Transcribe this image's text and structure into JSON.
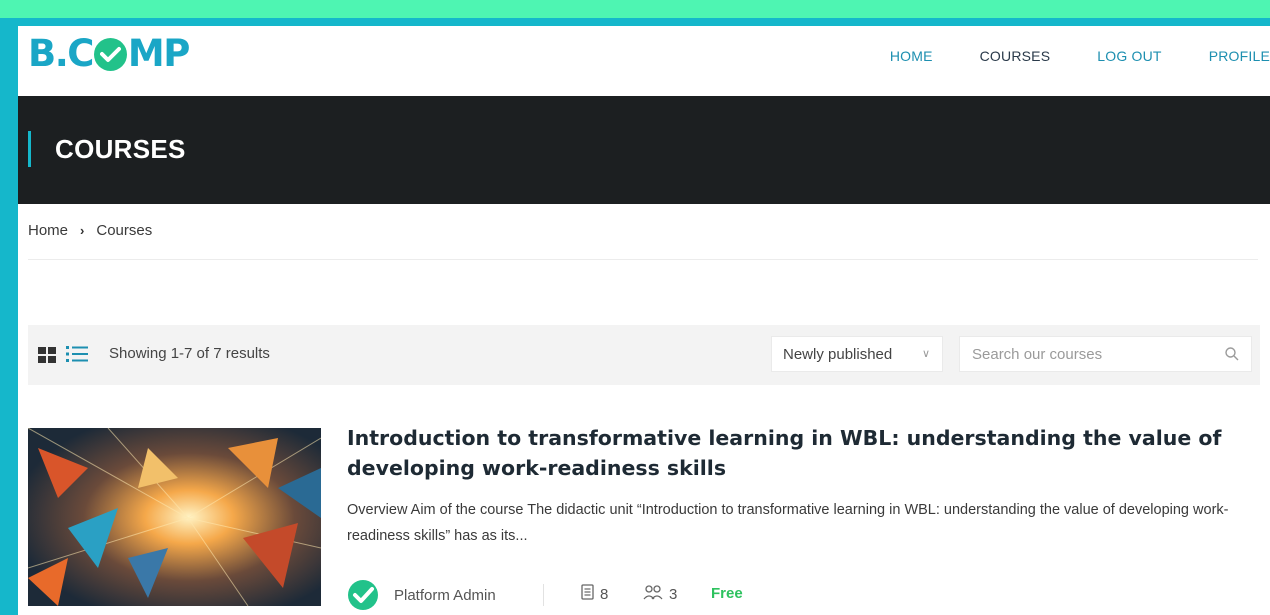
{
  "colors": {
    "frame_teal": "#15b7cb",
    "background_green": "#4ef5b2",
    "banner_dark": "#1c1f21",
    "nav_link": "#1d8fb0",
    "logo_check": "#22c28a",
    "price_green": "#2ec25f"
  },
  "header": {
    "logo_prefix": "B.C",
    "logo_suffix": "MP",
    "nav": [
      {
        "label": "HOME"
      },
      {
        "label": "COURSES"
      },
      {
        "label": "LOG OUT"
      },
      {
        "label": "PROFILE"
      }
    ]
  },
  "banner": {
    "title": "COURSES"
  },
  "breadcrumb": {
    "items": [
      "Home",
      "Courses"
    ],
    "separator": "›"
  },
  "toolbar": {
    "grid_view_icon": "grid-icon",
    "list_view_icon": "list-icon",
    "results_text": "Showing 1-7 of 7 results",
    "sort_selected": "Newly published",
    "search_placeholder": "Search our courses",
    "search_icon": "search-icon"
  },
  "courses": [
    {
      "title": "Introduction to transformative learning in WBL: understanding the value of developing work-readiness skills",
      "description": "Overview Aim of the course The didactic unit “Introduction to transformative learning in WBL: understanding the value of developing work-readiness skills” has as its...",
      "author": "Platform Admin",
      "lessons": "8",
      "students": "3",
      "price": "Free"
    }
  ]
}
